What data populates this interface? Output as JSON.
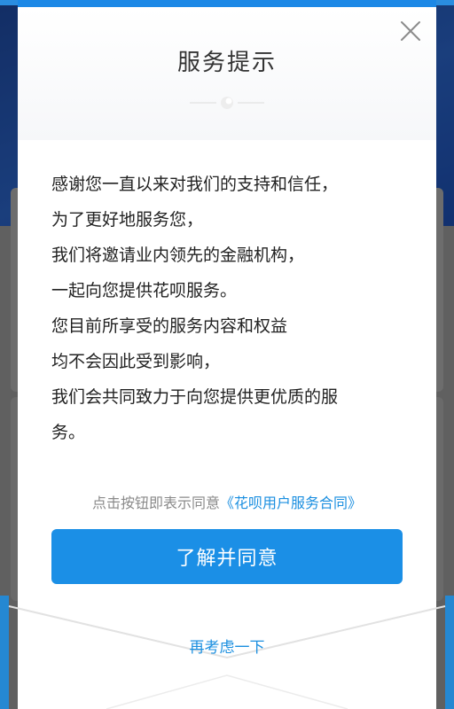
{
  "modal": {
    "title": "服务提示",
    "close_icon": "close-icon",
    "ornament_icon": "divider-ornament-icon",
    "body_lines": [
      "感谢您一直以来对我们的支持和信任，",
      "为了更好地服务您，",
      "我们将邀请业内领先的金融机构，",
      "一起向您提供花呗服务。",
      "您目前所享受的服务内容和权益",
      "均不会因此受到影响，",
      "我们会共同致力于向您提供更优质的服",
      "务。"
    ],
    "agreement_prefix": "点击按钮即表示同意",
    "agreement_link": "《花呗用户服务合同》",
    "agree_button": "了解并同意",
    "reconsider_link": "再考虑一下"
  },
  "colors": {
    "accent": "#1b8fe6",
    "link": "#1b8fe0",
    "title_text": "#333333",
    "body_text": "#222222",
    "muted_text": "#8a8a8a",
    "overlay_bg": "#606060"
  }
}
